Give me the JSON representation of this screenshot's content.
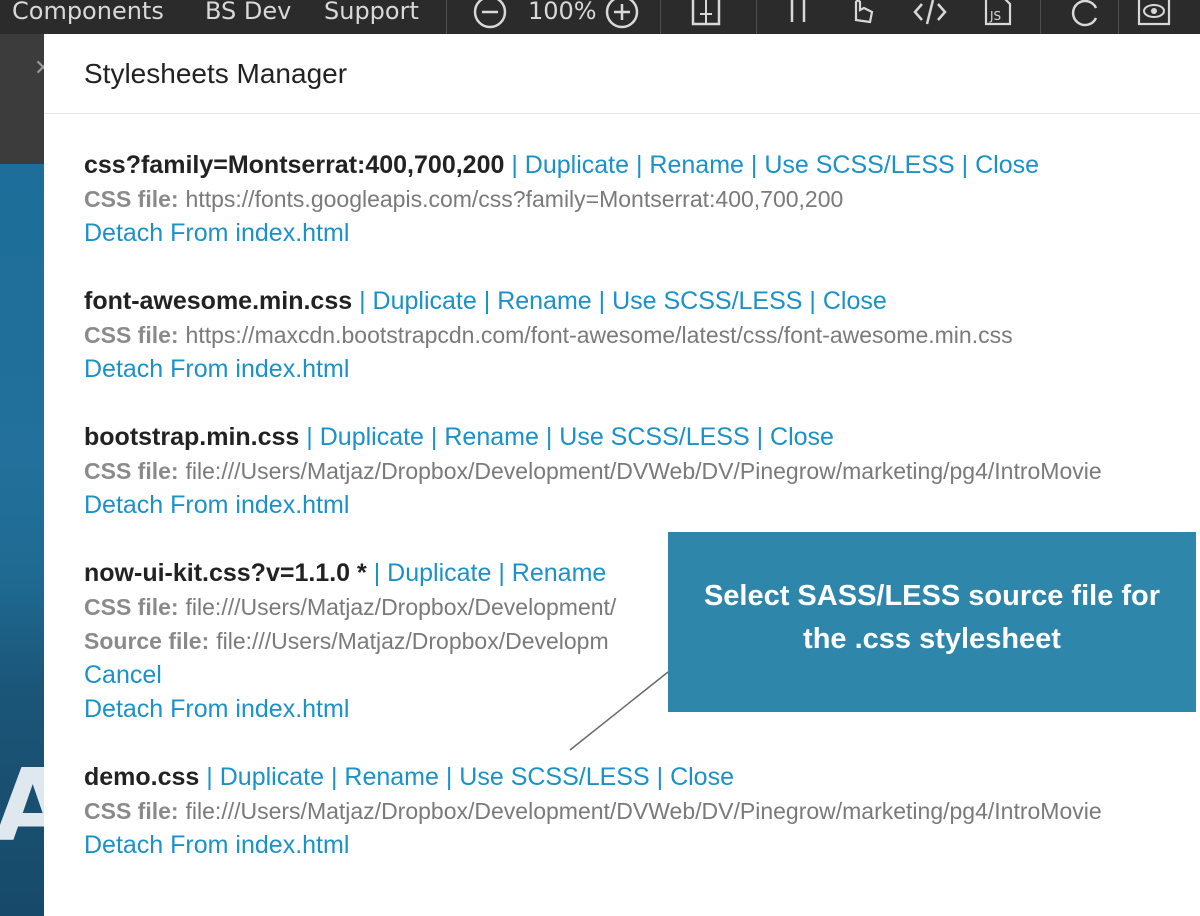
{
  "toolbar": {
    "menu": [
      "Components",
      "BS Dev",
      "Support"
    ],
    "zoom_level": "100%"
  },
  "modal": {
    "title": "Stylesheets Manager",
    "actions": {
      "duplicate": "Duplicate",
      "rename": "Rename",
      "use_scss": "Use SCSS/LESS",
      "close": "Close",
      "cancel": "Cancel",
      "detach": "Detach From index.html",
      "separator": "|"
    },
    "labels": {
      "css_file": "CSS file:",
      "source_file": "Source file:"
    },
    "stylesheets": [
      {
        "name": "css?family=Montserrat:400,700,200",
        "css_file": "https://fonts.googleapis.com/css?family=Montserrat:400,700,200"
      },
      {
        "name": "font-awesome.min.css",
        "css_file": "https://maxcdn.bootstrapcdn.com/font-awesome/latest/css/font-awesome.min.css"
      },
      {
        "name": "bootstrap.min.css",
        "css_file": "file:///Users/Matjaz/Dropbox/Development/DVWeb/DV/Pinegrow/marketing/pg4/IntroMovie"
      },
      {
        "name": "now-ui-kit.css?v=1.1.0 *",
        "css_file": "file:///Users/Matjaz/Dropbox/Development/",
        "source_file": "file:///Users/Matjaz/Dropbox/Developm"
      },
      {
        "name": "demo.css",
        "css_file": "file:///Users/Matjaz/Dropbox/Development/DVWeb/DV/Pinegrow/marketing/pg4/IntroMovie"
      }
    ]
  },
  "callout": {
    "line1": "Select SASS/LESS source file for",
    "line2": "the .css stylesheet"
  },
  "colors": {
    "link": "#1a91c9",
    "callout_bg": "#2e86aa",
    "toolbar_bg": "#2b2b2b"
  }
}
